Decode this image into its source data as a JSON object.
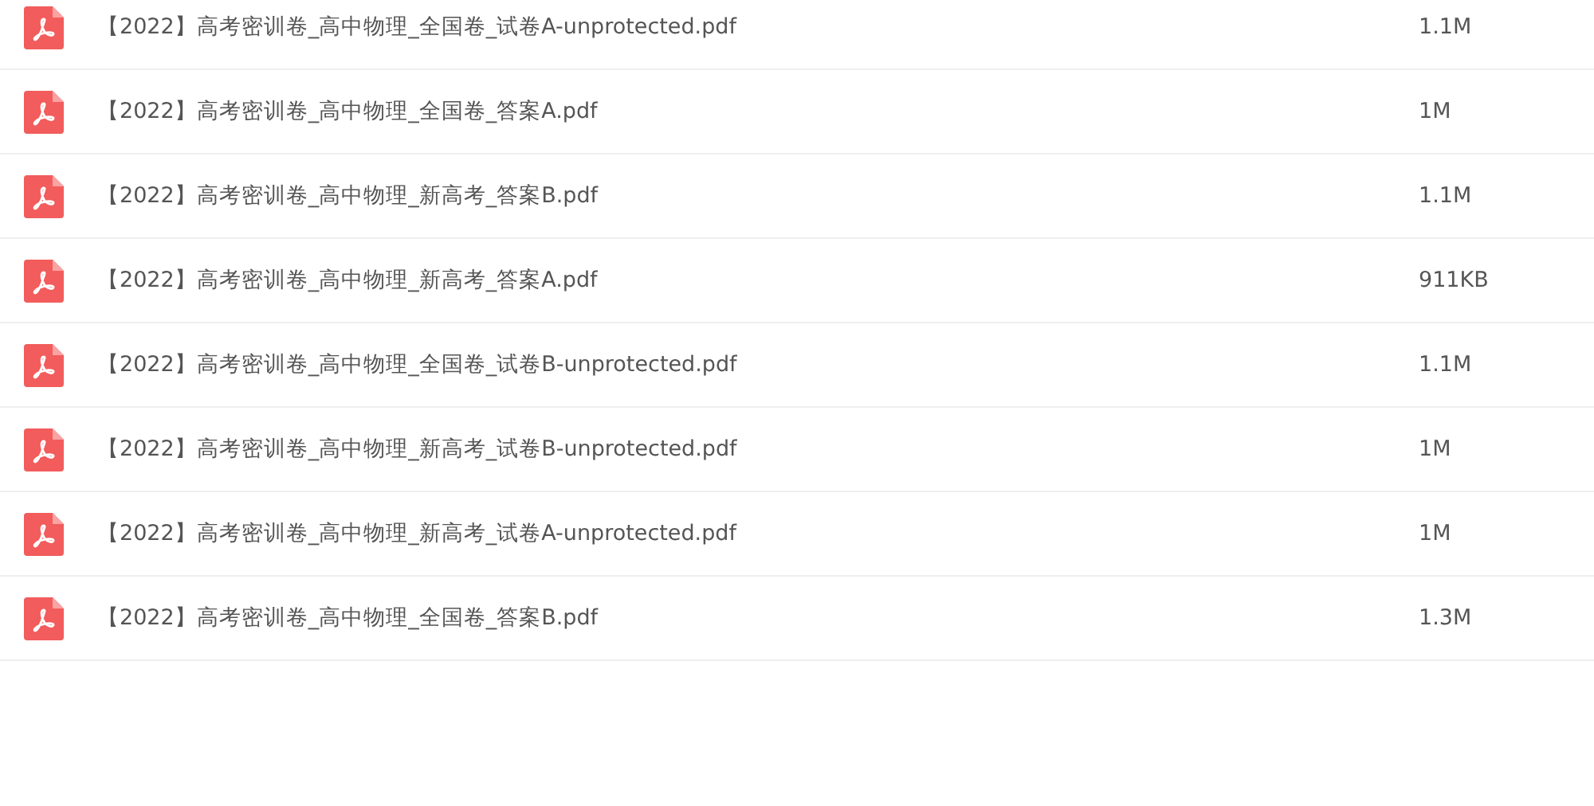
{
  "files": [
    {
      "name": "【2022】高考密训卷_高中物理_全国卷_试卷A-unprotected.pdf",
      "size": "1.1M"
    },
    {
      "name": "【2022】高考密训卷_高中物理_全国卷_答案A.pdf",
      "size": "1M"
    },
    {
      "name": "【2022】高考密训卷_高中物理_新高考_答案B.pdf",
      "size": "1.1M"
    },
    {
      "name": "【2022】高考密训卷_高中物理_新高考_答案A.pdf",
      "size": "911KB"
    },
    {
      "name": "【2022】高考密训卷_高中物理_全国卷_试卷B-unprotected.pdf",
      "size": "1.1M"
    },
    {
      "name": "【2022】高考密训卷_高中物理_新高考_试卷B-unprotected.pdf",
      "size": "1M"
    },
    {
      "name": "【2022】高考密训卷_高中物理_新高考_试卷A-unprotected.pdf",
      "size": "1M"
    },
    {
      "name": "【2022】高考密训卷_高中物理_全国卷_答案B.pdf",
      "size": "1.3M"
    }
  ]
}
